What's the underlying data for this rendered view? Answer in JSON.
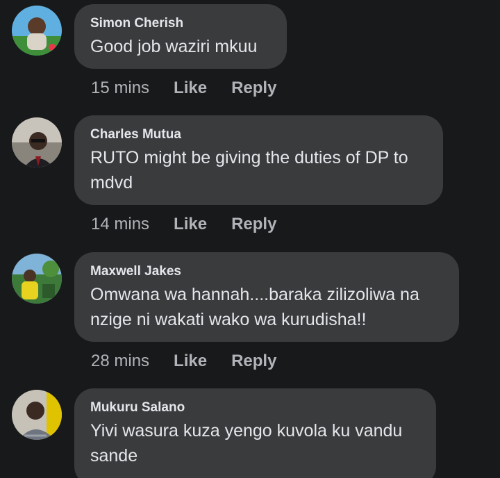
{
  "comments": [
    {
      "author": "Simon Cherish",
      "text": "Good job waziri mkuu",
      "time": "15 mins",
      "like_label": "Like",
      "reply_label": "Reply"
    },
    {
      "author": "Charles Mutua",
      "text": "RUTO might be giving the duties of DP to mdvd",
      "time": "14 mins",
      "like_label": "Like",
      "reply_label": "Reply"
    },
    {
      "author": "Maxwell Jakes",
      "text": "Omwana wa hannah....baraka zilizoliwa na nzige ni wakati wako wa kurudisha!!",
      "time": "28 mins",
      "like_label": "Like",
      "reply_label": "Reply"
    },
    {
      "author": "Mukuru Salano",
      "text": "Yivi wasura kuza yengo kuvola ku vandu sande",
      "time": "",
      "like_label": "",
      "reply_label": ""
    }
  ],
  "colors": {
    "background": "#18191a",
    "bubble": "#3a3b3c",
    "primary_text": "#e4e6eb",
    "secondary_text": "#b0b3b8"
  }
}
